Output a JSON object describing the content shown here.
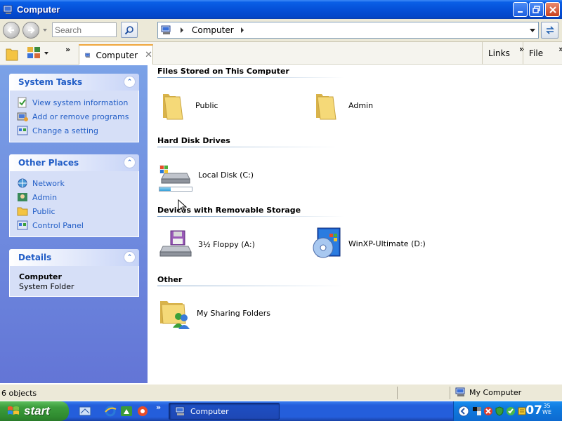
{
  "window": {
    "title": "Computer"
  },
  "toolbar": {
    "search_placeholder": "Search",
    "address_text": "Computer"
  },
  "tabbar": {
    "tab_label": "Computer",
    "tab_close": "✕",
    "links_label": "Links",
    "file_label": "File",
    "chevron": "»"
  },
  "sidebar": {
    "system_tasks": {
      "title": "System Tasks",
      "items": [
        "View system information",
        "Add or remove programs",
        "Change a setting"
      ]
    },
    "other_places": {
      "title": "Other Places",
      "items": [
        "Network",
        "Admin",
        "Public",
        "Control Panel"
      ]
    },
    "details": {
      "title": "Details",
      "name": "Computer",
      "type": "System Folder"
    }
  },
  "content": {
    "groups": [
      {
        "title": "Files Stored on This Computer",
        "items": [
          "Public",
          "Admin"
        ]
      },
      {
        "title": "Hard Disk Drives",
        "items": [
          "Local Disk (C:)"
        ]
      },
      {
        "title": "Devices with Removable Storage",
        "items": [
          "3½ Floppy (A:)",
          "WinXP-Ultimate (D:)"
        ]
      },
      {
        "title": "Other",
        "items": [
          "My Sharing Folders"
        ]
      }
    ],
    "disk_usage_fraction": 0.35
  },
  "status": {
    "objects": "6 objects",
    "location": "My Computer"
  },
  "taskbar": {
    "start_label": "start",
    "task_label": "Computer",
    "clock_hour": "07",
    "clock_min": "35",
    "clock_day": "WE"
  },
  "colors": {
    "accent": "#215dc6",
    "taskpane": "#6375d6",
    "titlebar": "#0550d8"
  }
}
